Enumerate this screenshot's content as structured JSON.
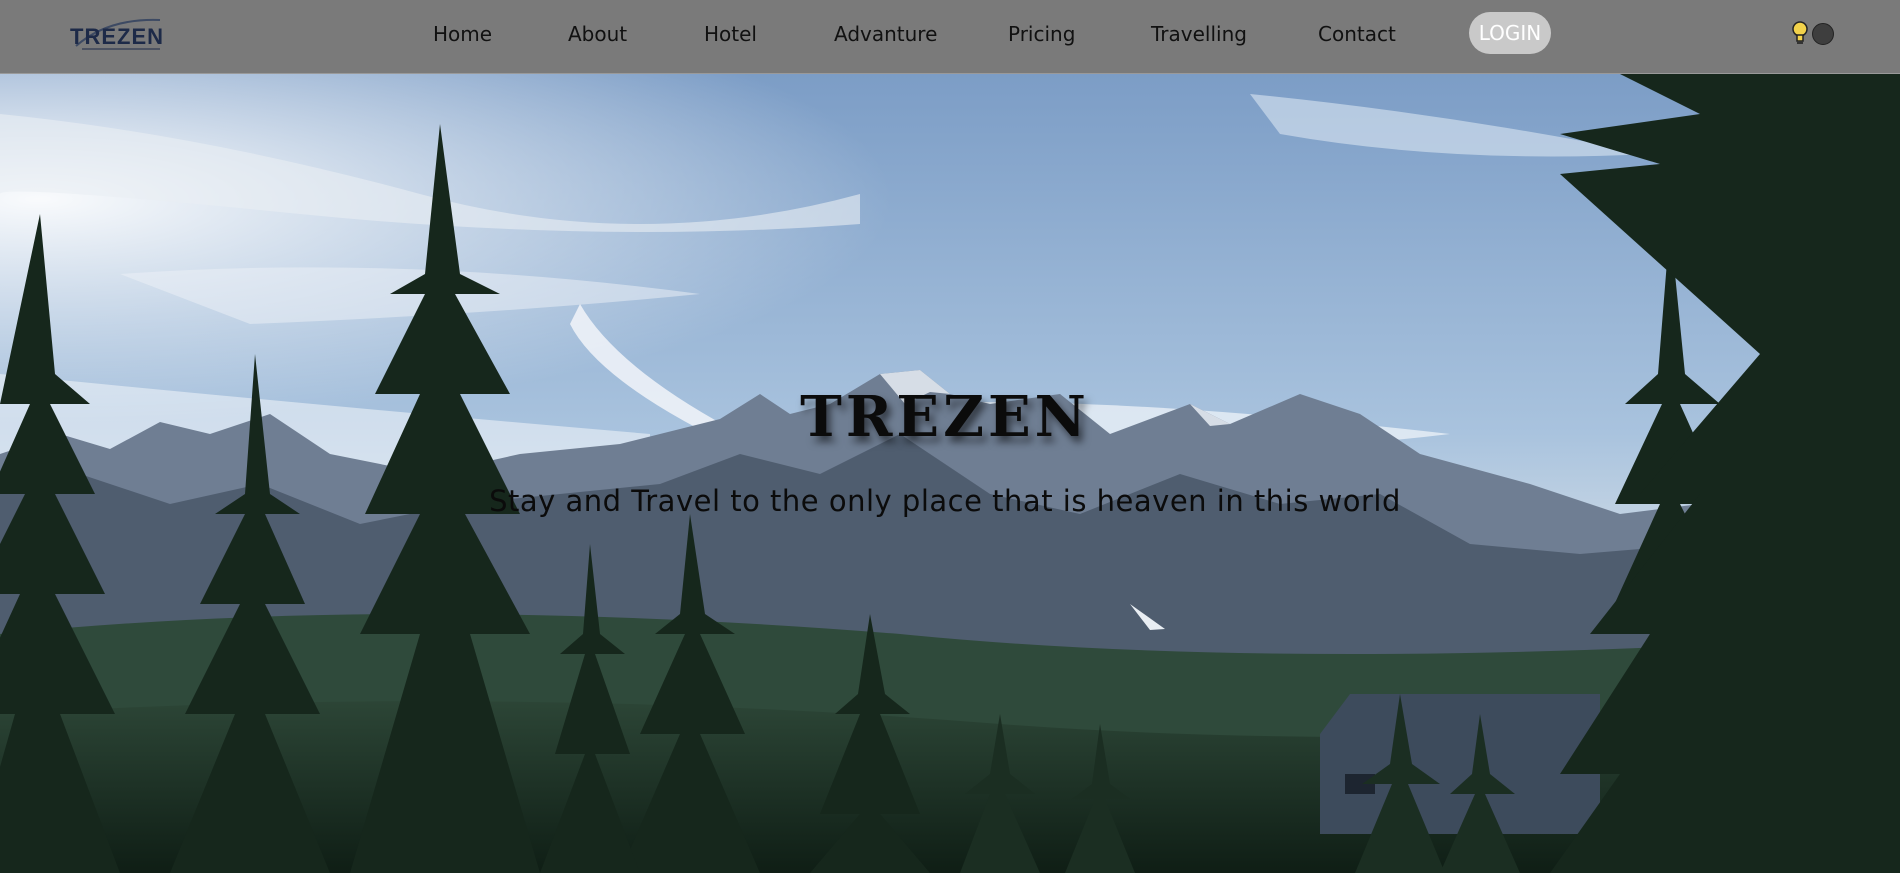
{
  "brand": {
    "logo_text": "TREZEN"
  },
  "nav": {
    "items": [
      {
        "label": "Home"
      },
      {
        "label": "About"
      },
      {
        "label": "Hotel"
      },
      {
        "label": "Advanture"
      },
      {
        "label": "Pricing"
      },
      {
        "label": "Travelling"
      },
      {
        "label": "Contact"
      }
    ],
    "login_label": "LOGIN",
    "theme_icons": [
      "lightbulb-icon",
      "dark-mode-toggle"
    ]
  },
  "hero": {
    "title": "TREZEN",
    "tagline": "Stay and Travel to the only place that is heaven in this world"
  },
  "colors": {
    "navbar_bg": "#7a7a7a",
    "login_bg": "#c9c9c9",
    "text_dark": "#0b0b0b",
    "sky": "#8faed3",
    "forest": "#1f3326"
  }
}
